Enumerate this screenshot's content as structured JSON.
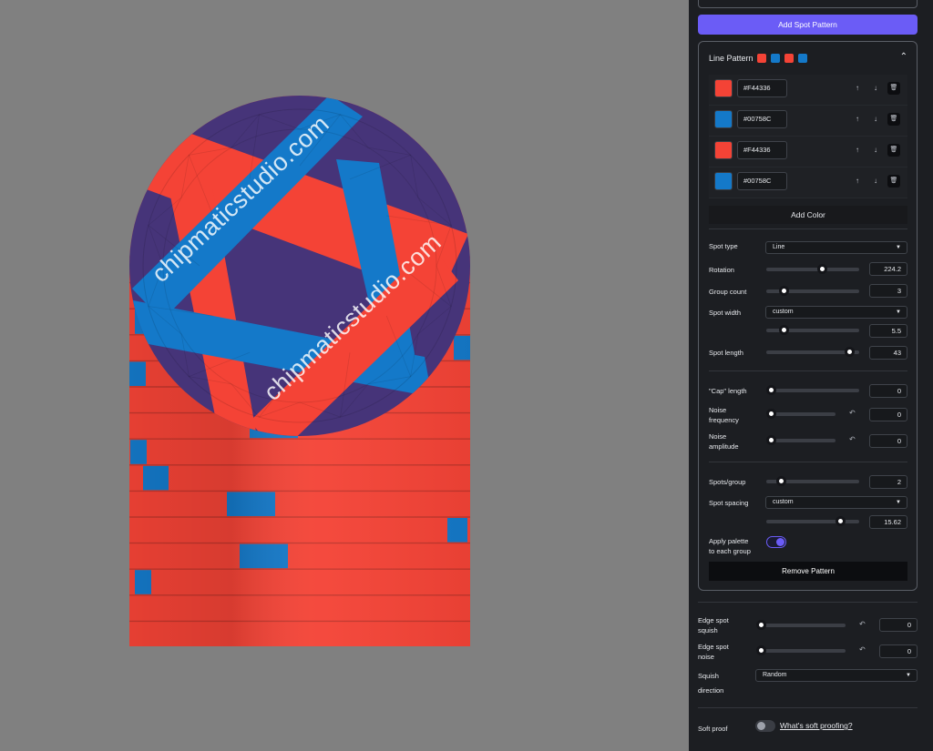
{
  "canvas": {
    "background": "#808080",
    "watermark_1": "chipmaticstudio.com",
    "watermark_2": "chipmaticstudio.com",
    "colors": {
      "red": "#F44336",
      "blue": "#00758C",
      "purple": "#463479"
    }
  },
  "panel": {
    "add_spot_pattern_label": "Add Spot Pattern",
    "line_pattern": {
      "title": "Line Pattern",
      "swatches": [
        "#F44336",
        "#1479C9",
        "#F44336",
        "#1479C9"
      ],
      "colors": [
        {
          "hex": "#F44336",
          "display": "#F44336"
        },
        {
          "hex": "#1479C9",
          "display": "#00758C"
        },
        {
          "hex": "#F44336",
          "display": "#F44336"
        },
        {
          "hex": "#1479C9",
          "display": "#00758C"
        }
      ],
      "add_color_label": "Add Color",
      "spot_type": {
        "label": "Spot type",
        "value": "Line"
      },
      "rotation": {
        "label": "Rotation",
        "value": "224.2",
        "fraction": 0.61
      },
      "group_count": {
        "label": "Group count",
        "value": "3",
        "fraction": 0.15
      },
      "spot_width": {
        "label": "Spot width",
        "mode": "custom",
        "value": "5.5",
        "fraction": 0.15
      },
      "spot_length": {
        "label": "Spot length",
        "value": "43",
        "fraction": 0.95
      },
      "cap_length": {
        "label": "\"Cap\" length",
        "value": "0",
        "fraction": 0.0
      },
      "noise_frequency": {
        "label_1": "Noise",
        "label_2": "frequency",
        "value": "0",
        "fraction": 0.0
      },
      "noise_amplitude": {
        "label_1": "Noise",
        "label_2": "amplitude",
        "value": "0",
        "fraction": 0.0
      },
      "spots_per_group": {
        "label": "Spots/group",
        "value": "2",
        "fraction": 0.12
      },
      "spot_spacing": {
        "label": "Spot spacing",
        "mode": "custom",
        "value": "15.62",
        "fraction": 0.83
      },
      "apply_palette": {
        "label_1": "Apply palette",
        "label_2": "to each group",
        "on": true
      },
      "remove_label": "Remove Pattern"
    },
    "edge_spot_squish": {
      "label_1": "Edge spot",
      "label_2": "squish",
      "value": "0",
      "fraction": 0.0
    },
    "edge_spot_noise": {
      "label_1": "Edge spot",
      "label_2": "noise",
      "value": "0",
      "fraction": 0.0
    },
    "squish_direction": {
      "label_1": "Squish",
      "label_2": "direction",
      "value": "Random"
    },
    "soft_proof": {
      "label": "Soft proof",
      "on": false,
      "link": "What's soft proofing?"
    },
    "accent": "#6b5cf6"
  }
}
